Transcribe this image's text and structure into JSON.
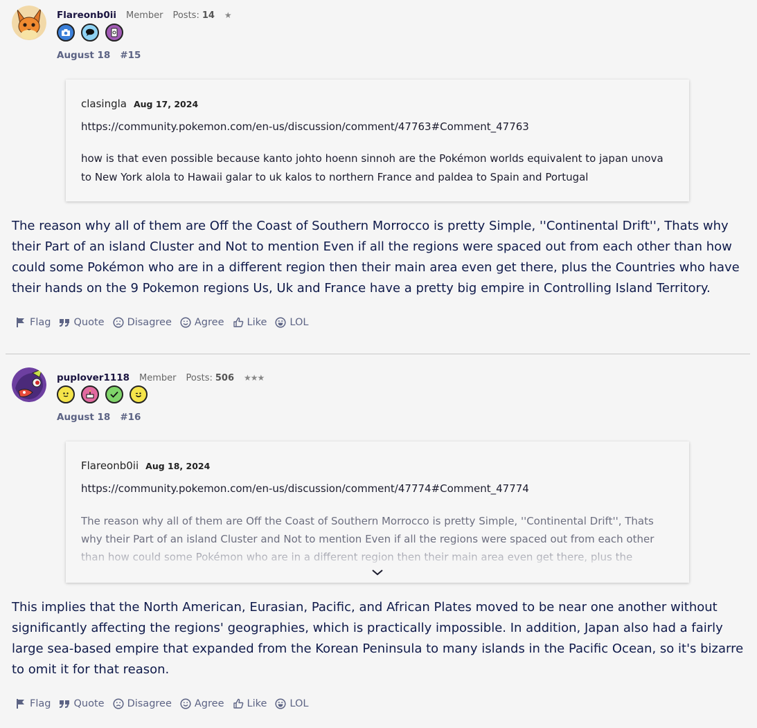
{
  "posts": [
    {
      "username": "Flareonb0ii",
      "role": "Member",
      "posts_label": "Posts:",
      "posts_count": "14",
      "stars": "★",
      "badges": [
        "camera-badge",
        "comment-badge",
        "notebook-badge"
      ],
      "date": "August 18",
      "number": "#15",
      "quote": {
        "author": "clasingla",
        "date": "Aug 17, 2024",
        "link": "https://community.pokemon.com/en-us/discussion/comment/47763#Comment_47763",
        "text": "how is that even possible because kanto johto hoenn sinnoh are the Pokémon worlds equivalent to japan unova to New York alola to Hawaii galar to uk kalos to northern France and paldea to Spain and Portugal"
      },
      "body": "The reason why all of them are Off the Coast of Southern Morrocco is pretty Simple, ''Continental Drift'', Thats why their Part of an island Cluster and Not to mention Even if all the regions were spaced out from each other than how could some Pokémon who are in a different region then their main area even get there, plus the Countries who have their hands on the 9 Pokemon regions Us, Uk and France have a pretty big empire in Controlling Island Territory."
    },
    {
      "username": "puplover1118",
      "role": "Member",
      "posts_label": "Posts:",
      "posts_count": "506",
      "stars": "★★★",
      "badges": [
        "smiley-badge",
        "cake-badge",
        "check-badge",
        "wink-badge"
      ],
      "date": "August 18",
      "number": "#16",
      "quote": {
        "author": "Flareonb0ii",
        "date": "Aug 18, 2024",
        "link": "https://community.pokemon.com/en-us/discussion/comment/47774#Comment_47774",
        "text": "The reason why all of them are Off the Coast of Southern Morrocco is pretty Simple, ''Continental Drift'', Thats why their Part of an island Cluster and Not to mention Even if all the regions were spaced out from each other than how could some Pokémon who are in a different region then their main area even get there, plus the Countries"
      },
      "body": "This implies that the North American, Eurasian, Pacific, and African Plates moved to be near one another without significantly affecting the regions' geographies, which is practically impossible. In addition, Japan also had a fairly large sea-based empire that expanded from the Korean Peninsula to many islands in the Pacific Ocean, so it's bizarre to omit it for that reason."
    }
  ],
  "actions": {
    "flag": "Flag",
    "quote": "Quote",
    "disagree": "Disagree",
    "agree": "Agree",
    "like": "Like",
    "lol": "LOL"
  },
  "colors": {
    "text": "#0f1a4a",
    "muted": "#5c6384",
    "background": "#f5f5f5"
  }
}
